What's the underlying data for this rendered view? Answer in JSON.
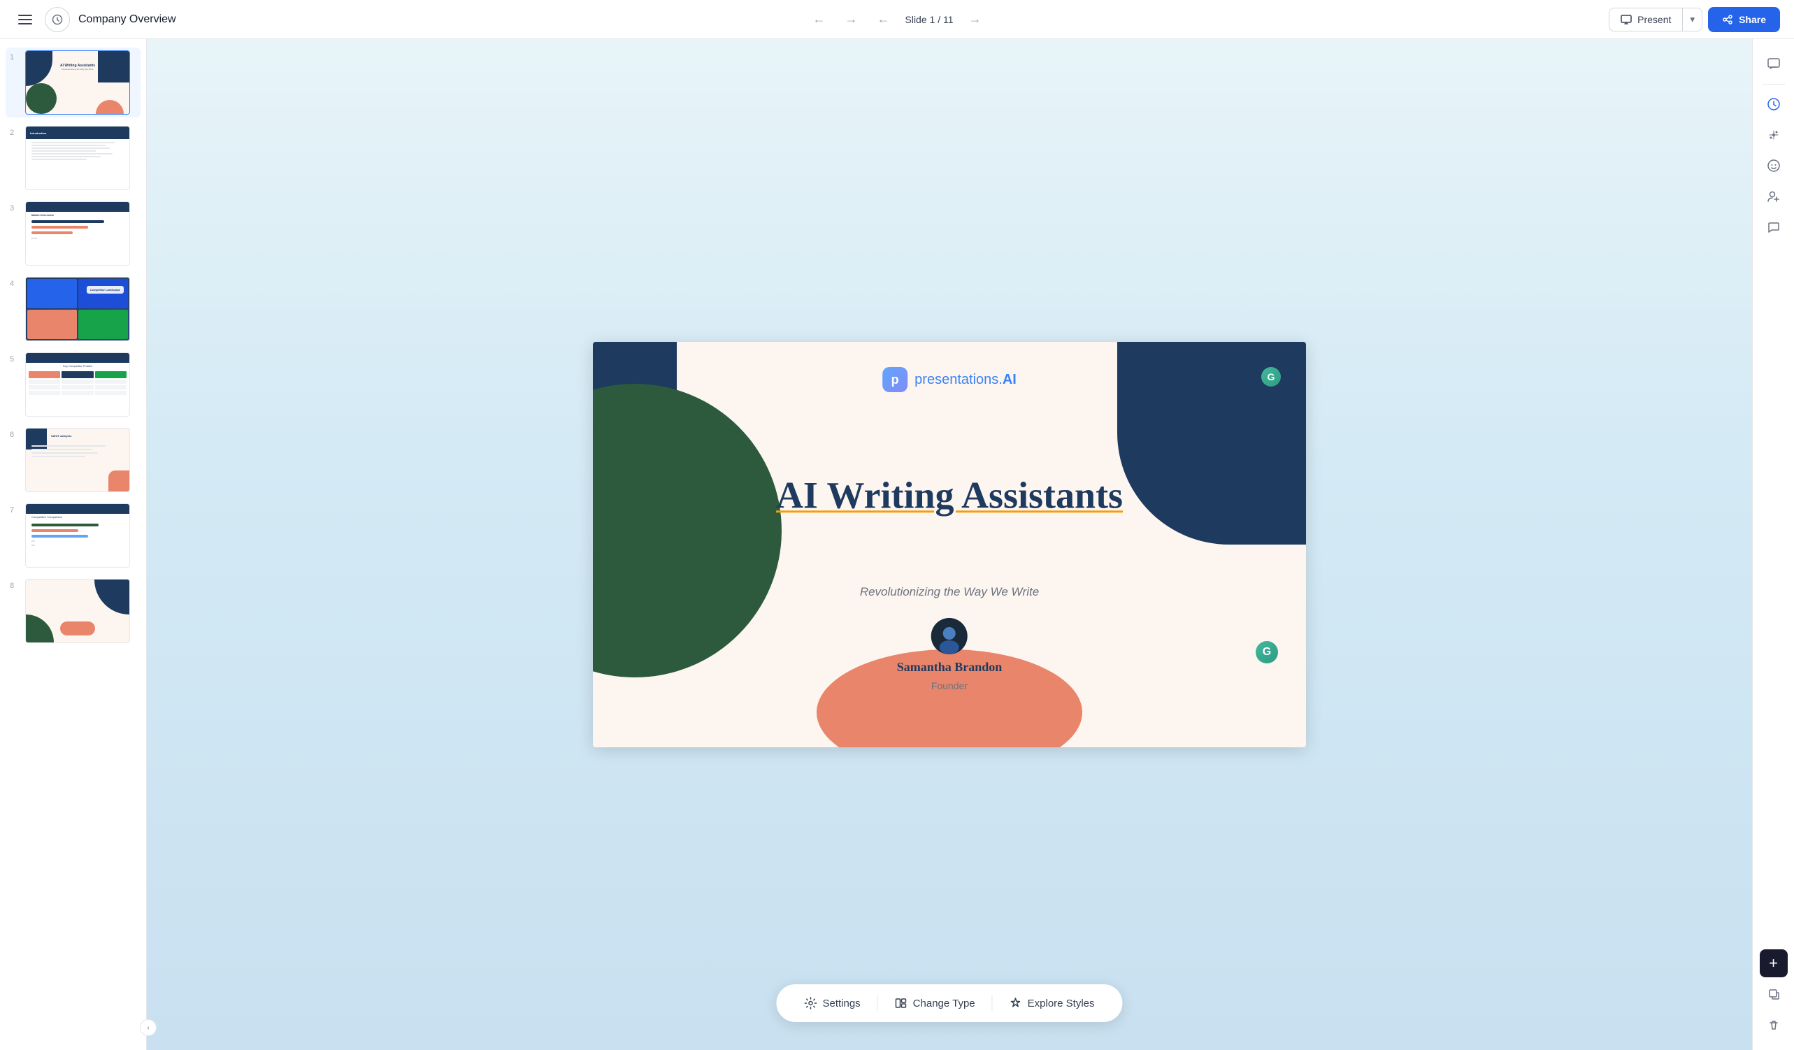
{
  "app": {
    "title": "Company Overview"
  },
  "topbar": {
    "doc_title": "Company Overview",
    "slide_indicator": "Slide 1 / 11",
    "present_label": "Present",
    "share_label": "Share"
  },
  "sidebar": {
    "slides": [
      {
        "num": "1",
        "label": "Slide 1",
        "active": true
      },
      {
        "num": "2",
        "label": "Slide 2"
      },
      {
        "num": "3",
        "label": "Slide 3"
      },
      {
        "num": "4",
        "label": "Slide 4"
      },
      {
        "num": "5",
        "label": "Slide 5"
      },
      {
        "num": "6",
        "label": "Slide 6"
      },
      {
        "num": "7",
        "label": "Slide 7"
      },
      {
        "num": "8",
        "label": "Slide 8"
      }
    ]
  },
  "slide1": {
    "logo_text": "presentations.",
    "logo_suffix": "AI",
    "main_title": "AI Writing Assistants",
    "subtitle": "Revolutionizing the Way We Write",
    "presenter_name": "Samantha Brandon",
    "presenter_role": "Founder"
  },
  "slide4_label": "Competitor Landscape",
  "toolbar": {
    "settings_label": "Settings",
    "change_type_label": "Change Type",
    "explore_styles_label": "Explore Styles"
  }
}
